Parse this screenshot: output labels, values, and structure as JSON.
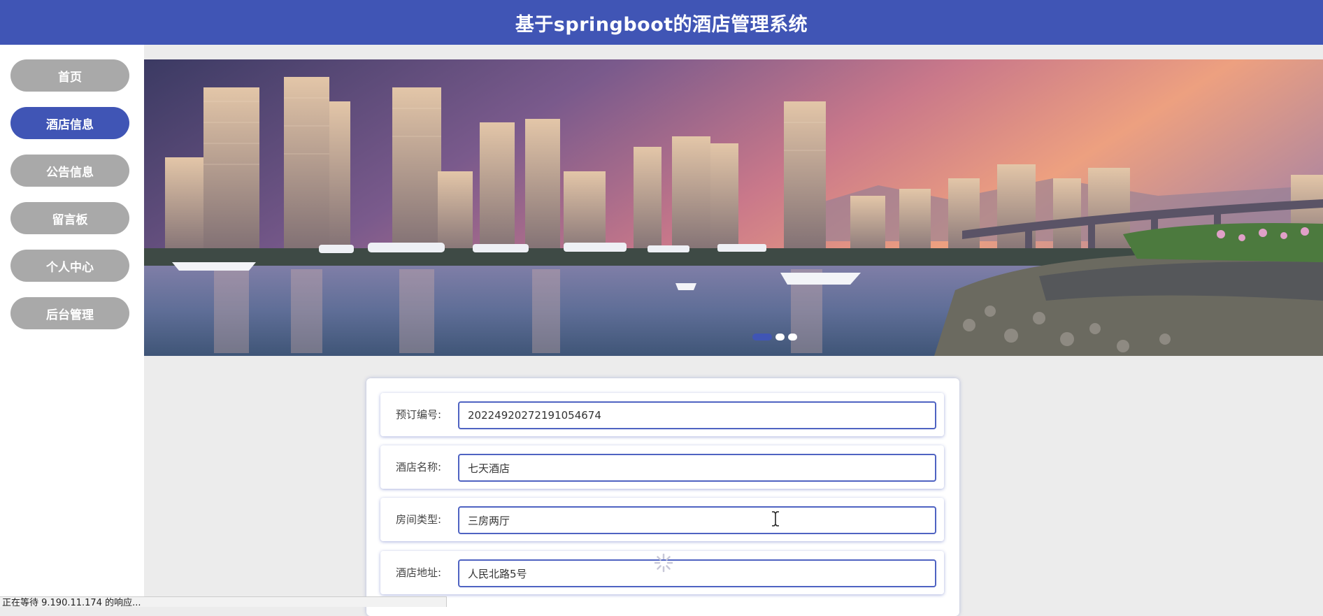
{
  "header": {
    "title": "基于springboot的酒店管理系统",
    "bg_color": "#4055b5"
  },
  "sidebar": {
    "items": [
      {
        "label": "首页",
        "active": false
      },
      {
        "label": "酒店信息",
        "active": true
      },
      {
        "label": "公告信息",
        "active": false
      },
      {
        "label": "留言板",
        "active": false
      },
      {
        "label": "个人中心",
        "active": false
      },
      {
        "label": "后台管理",
        "active": false
      }
    ],
    "active_color": "#4055b5",
    "inactive_color": "#a9a9a9"
  },
  "banner": {
    "description_icon": "city-waterfront-image",
    "slide_count": 3,
    "active_slide": 1
  },
  "form": {
    "fields": [
      {
        "label": "预订编号:",
        "value": "20224920272191054674"
      },
      {
        "label": "酒店名称:",
        "value": "七天酒店"
      },
      {
        "label": "房间类型:",
        "value": "三房两厅"
      },
      {
        "label": "酒店地址:",
        "value": "人民北路5号"
      }
    ]
  },
  "status_bar": {
    "text": "正在等待 9.190.11.174 的响应..."
  }
}
